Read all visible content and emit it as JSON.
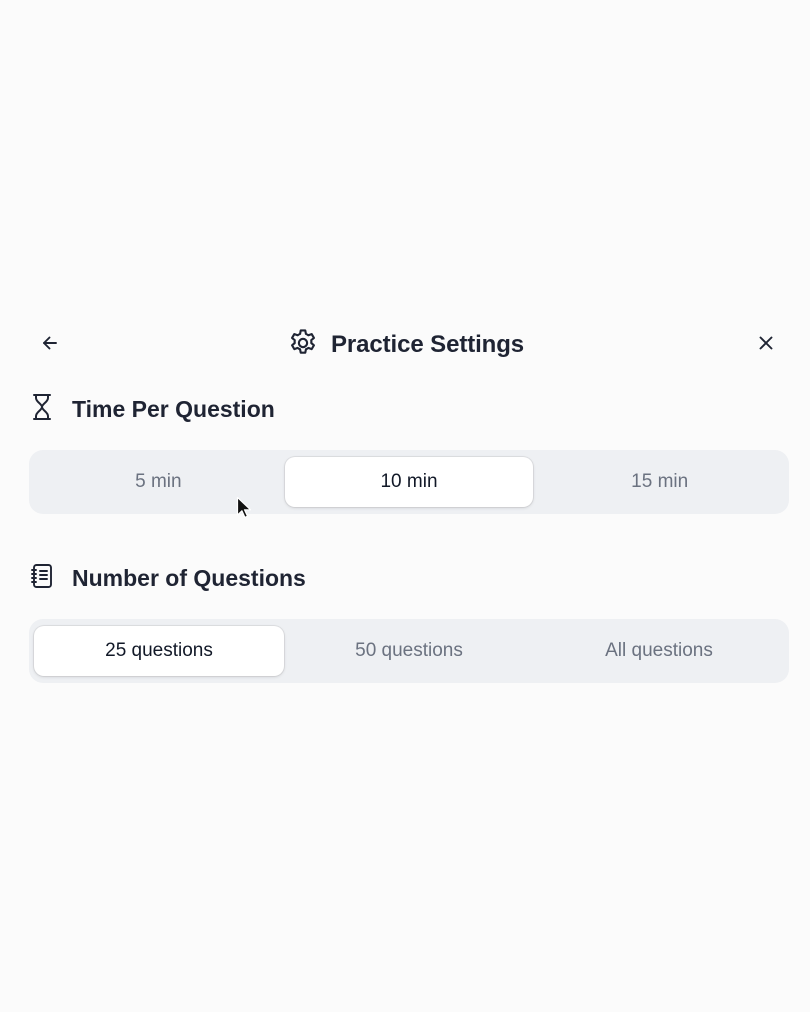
{
  "header": {
    "title": "Practice Settings",
    "back_icon": "arrow-left-icon",
    "settings_icon": "gear-icon",
    "close_icon": "close-icon"
  },
  "time_section": {
    "title": "Time Per Question",
    "icon": "hourglass-icon",
    "options": [
      "5 min",
      "10 min",
      "15 min"
    ],
    "selected": "10 min"
  },
  "questions_section": {
    "title": "Number of Questions",
    "icon": "notebook-icon",
    "options": [
      "25 questions",
      "50 questions",
      "All questions"
    ],
    "selected": "25 questions"
  },
  "colors": {
    "track": "#eef0f3",
    "selected_bg": "#ffffff",
    "text_primary": "#1f2433",
    "text_muted": "#6b7280"
  }
}
